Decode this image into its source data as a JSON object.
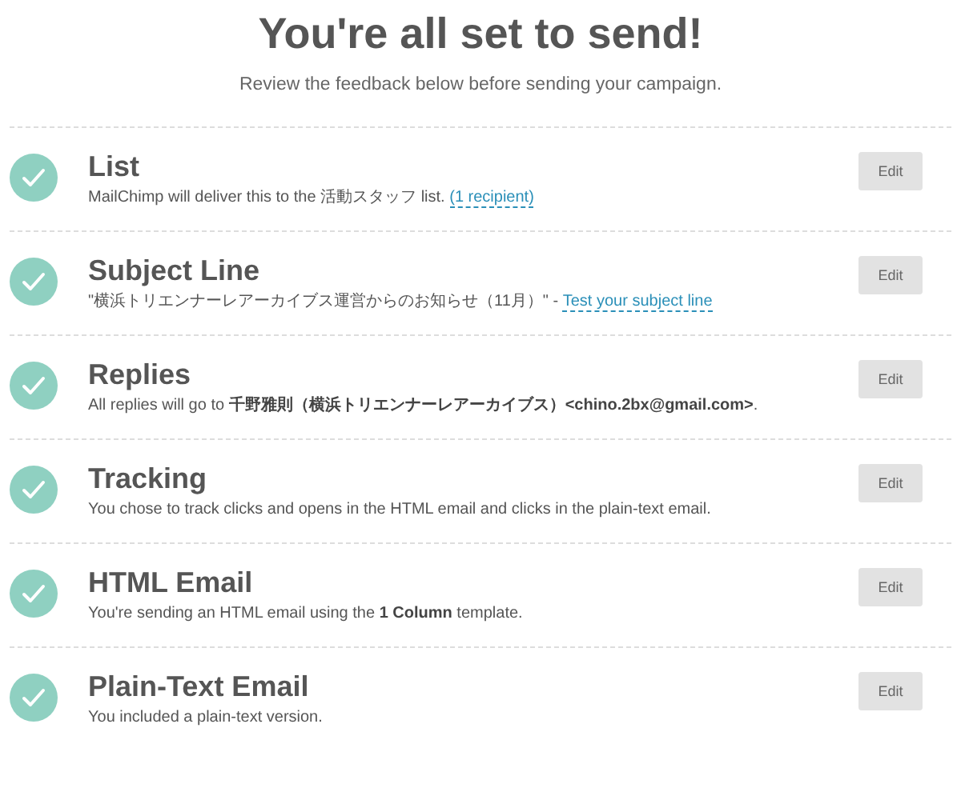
{
  "header": {
    "title": "You're all set to send!",
    "subtitle": "Review the feedback below before sending your campaign."
  },
  "checklist": [
    {
      "title": "List",
      "complete": true,
      "description": "MailChimp will deliver this to the 活動スタッフ list. ",
      "link": "(1 recipient)",
      "button": "Edit"
    },
    {
      "title": "Subject Line",
      "complete": true,
      "description": "\"横浜トリエンナーレアーカイブス運営からのお知らせ（11月）\" - ",
      "link": "Test your subject line",
      "button": "Edit"
    },
    {
      "title": "Replies",
      "complete": true,
      "description": "All replies will go to **千野雅則（横浜トリエンナーレアーカイブス）<chino.2bx@gmail.com>**.",
      "button": "Edit"
    },
    {
      "title": "Tracking",
      "complete": true,
      "description": "You chose to track clicks and opens in the HTML email and clicks in the plain-text email.",
      "button": "Edit"
    },
    {
      "title": "HTML Email",
      "complete": true,
      "description": "You're sending an HTML email using the **1 Column** template.",
      "button": "Edit"
    },
    {
      "title": "Plain-Text Email",
      "complete": true,
      "description": "You included a plain-text version.",
      "button": "Edit"
    }
  ]
}
